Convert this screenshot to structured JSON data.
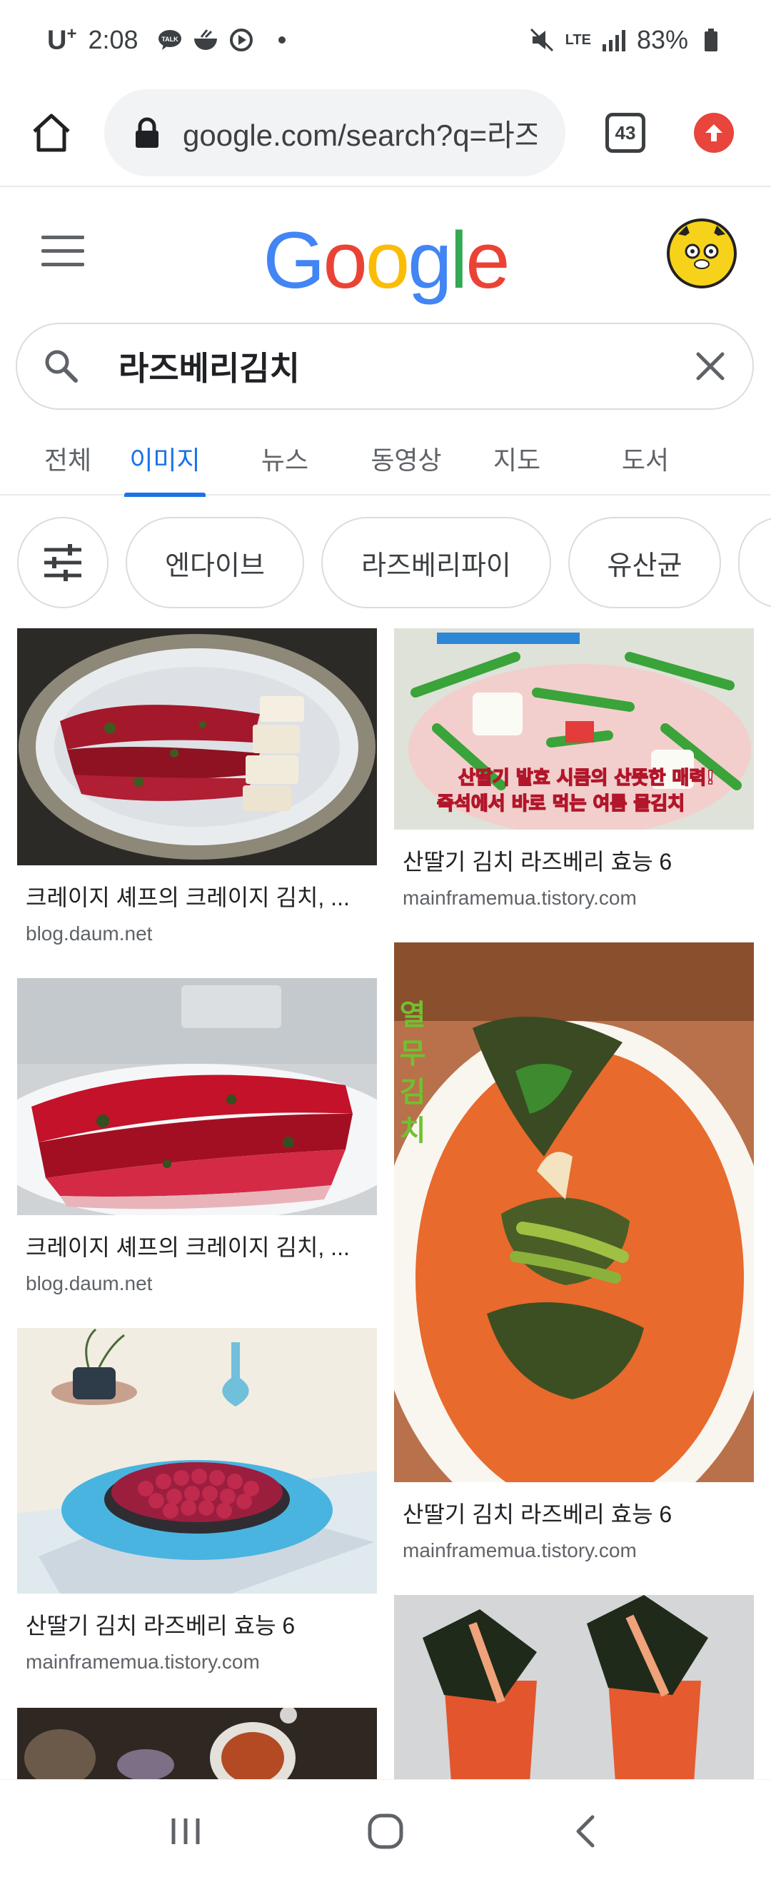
{
  "status_bar": {
    "carrier": "U",
    "carrier_sup": "+",
    "time": "2:08",
    "battery": "83%",
    "network": "LTE"
  },
  "browser": {
    "url": "google.com/search?q=라즈",
    "tab_count": "43"
  },
  "logo": {
    "letters": [
      "G",
      "o",
      "o",
      "g",
      "l",
      "e"
    ],
    "colors": [
      "#4285F4",
      "#EA4335",
      "#FBBC05",
      "#4285F4",
      "#34A853",
      "#EA4335"
    ]
  },
  "search": {
    "query": "라즈베리김치"
  },
  "tabs": [
    {
      "label": "전체",
      "active": false
    },
    {
      "label": "이미지",
      "active": true
    },
    {
      "label": "뉴스",
      "active": false
    },
    {
      "label": "동영상",
      "active": false
    },
    {
      "label": "지도",
      "active": false
    },
    {
      "label": "도서",
      "active": false
    }
  ],
  "chips": [
    {
      "label": "엔다이브"
    },
    {
      "label": "라즈베리파이"
    },
    {
      "label": "유산균"
    }
  ],
  "results": [
    {
      "title": "크레이지 셰프의 크레이지 김치, ...",
      "source": "blog.daum.net"
    },
    {
      "title": "산딸기 김치 라즈베리 효능 6",
      "source": "mainframemua.tistory.com"
    },
    {
      "title": "크레이지 셰프의 크레이지 김치, ...",
      "source": "blog.daum.net"
    },
    {
      "title": "산딸기 김치 라즈베리 효능 6",
      "source": "mainframemua.tistory.com"
    },
    {
      "title": "산딸기 김치 라즈베리 효능 6",
      "source": "mainframemua.tistory.com"
    }
  ],
  "image_texts": {
    "radish_caption_1": "산딸기 발효 시큼의 산뜻한 매력!",
    "radish_caption_2": "즉석에서 바로 먹는 여름 물김치",
    "vertical_title": "열 무 김 치"
  },
  "colors": {
    "accent": "#1a73e8",
    "border": "#dadce0",
    "text_secondary": "#5f6368"
  }
}
